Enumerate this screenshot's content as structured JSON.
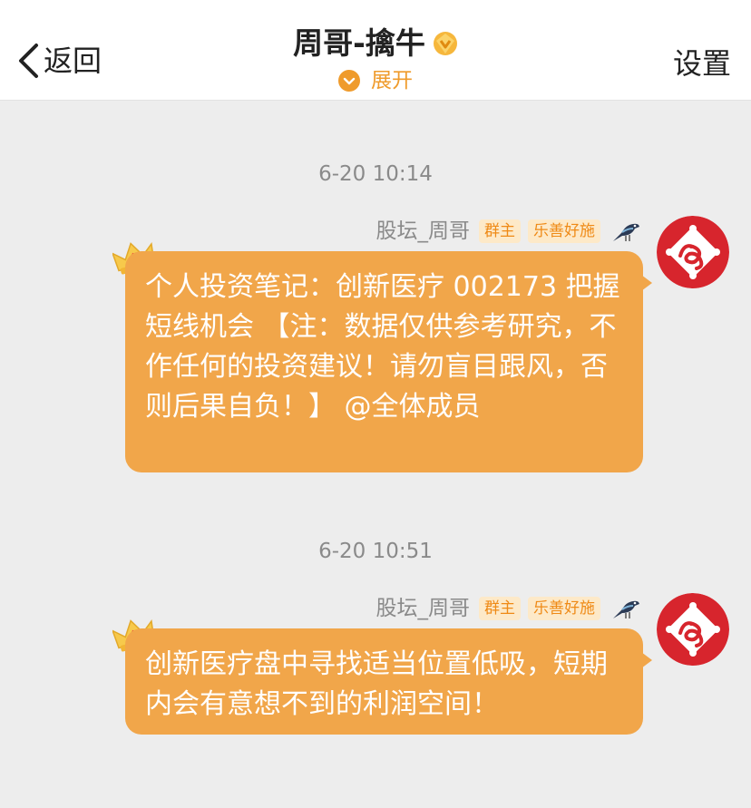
{
  "header": {
    "back_label": "返回",
    "title": "周哥-擒牛",
    "expand_label": "展开",
    "settings_label": "设置",
    "accent_color": "#ef9b2c"
  },
  "messages": [
    {
      "timestamp": "6-20 10:14",
      "sender": "股坛_周哥",
      "badge_owner": "群主",
      "badge_title": "乐善好施",
      "text": "个人投资笔记：创新医疗 002173 把握短线机会 【注：数据仅供参考研究，不作任何的投资建议！请勿盲目跟风，否则后果自负！】 @全体成员"
    },
    {
      "timestamp": "6-20 10:51",
      "sender": "股坛_周哥",
      "badge_owner": "群主",
      "badge_title": "乐善好施",
      "text": "创新医疗盘中寻找适当位置低吸，短期内会有意想不到的利润空间！"
    }
  ],
  "icons": {
    "back": "chevron-left-icon",
    "vip": "vip-badge-icon",
    "expand": "chevron-down-circle-icon",
    "crown": "crown-icon",
    "bird": "magpie-icon",
    "avatar": "snake-fortune-avatar"
  },
  "colors": {
    "bubble": "#f1a64a",
    "background": "#ededed",
    "badge_text": "#ef8a16",
    "badge_bg": "#fde9c8"
  }
}
